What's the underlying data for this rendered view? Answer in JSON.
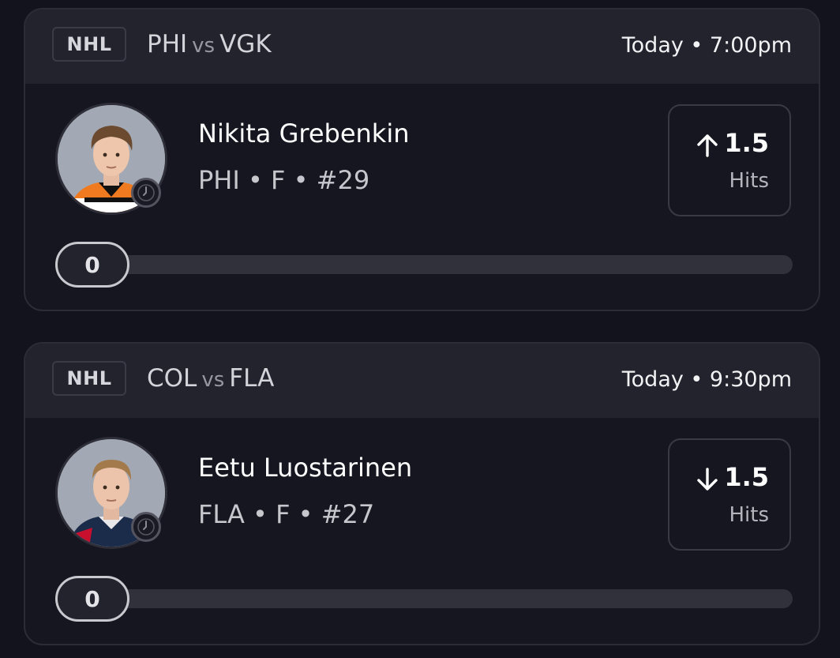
{
  "cards": [
    {
      "league": "NHL",
      "home_team": "PHI",
      "vs": "vs",
      "away_team": "VGK",
      "time": "Today • 7:00pm",
      "player_name": "Nikita Grebenkin",
      "player_meta": "PHI • F • #29",
      "direction": "up",
      "line": "1.5",
      "stat": "Hits",
      "progress": "0",
      "progress_fraction": 0,
      "jersey_color": "#f07a1f"
    },
    {
      "league": "NHL",
      "home_team": "COL",
      "vs": "vs",
      "away_team": "FLA",
      "time": "Today • 9:30pm",
      "player_name": "Eetu Luostarinen",
      "player_meta": "FLA • F • #27",
      "direction": "down",
      "line": "1.5",
      "stat": "Hits",
      "progress": "0",
      "progress_fraction": 0,
      "jersey_color": "#1b2b4a"
    }
  ]
}
